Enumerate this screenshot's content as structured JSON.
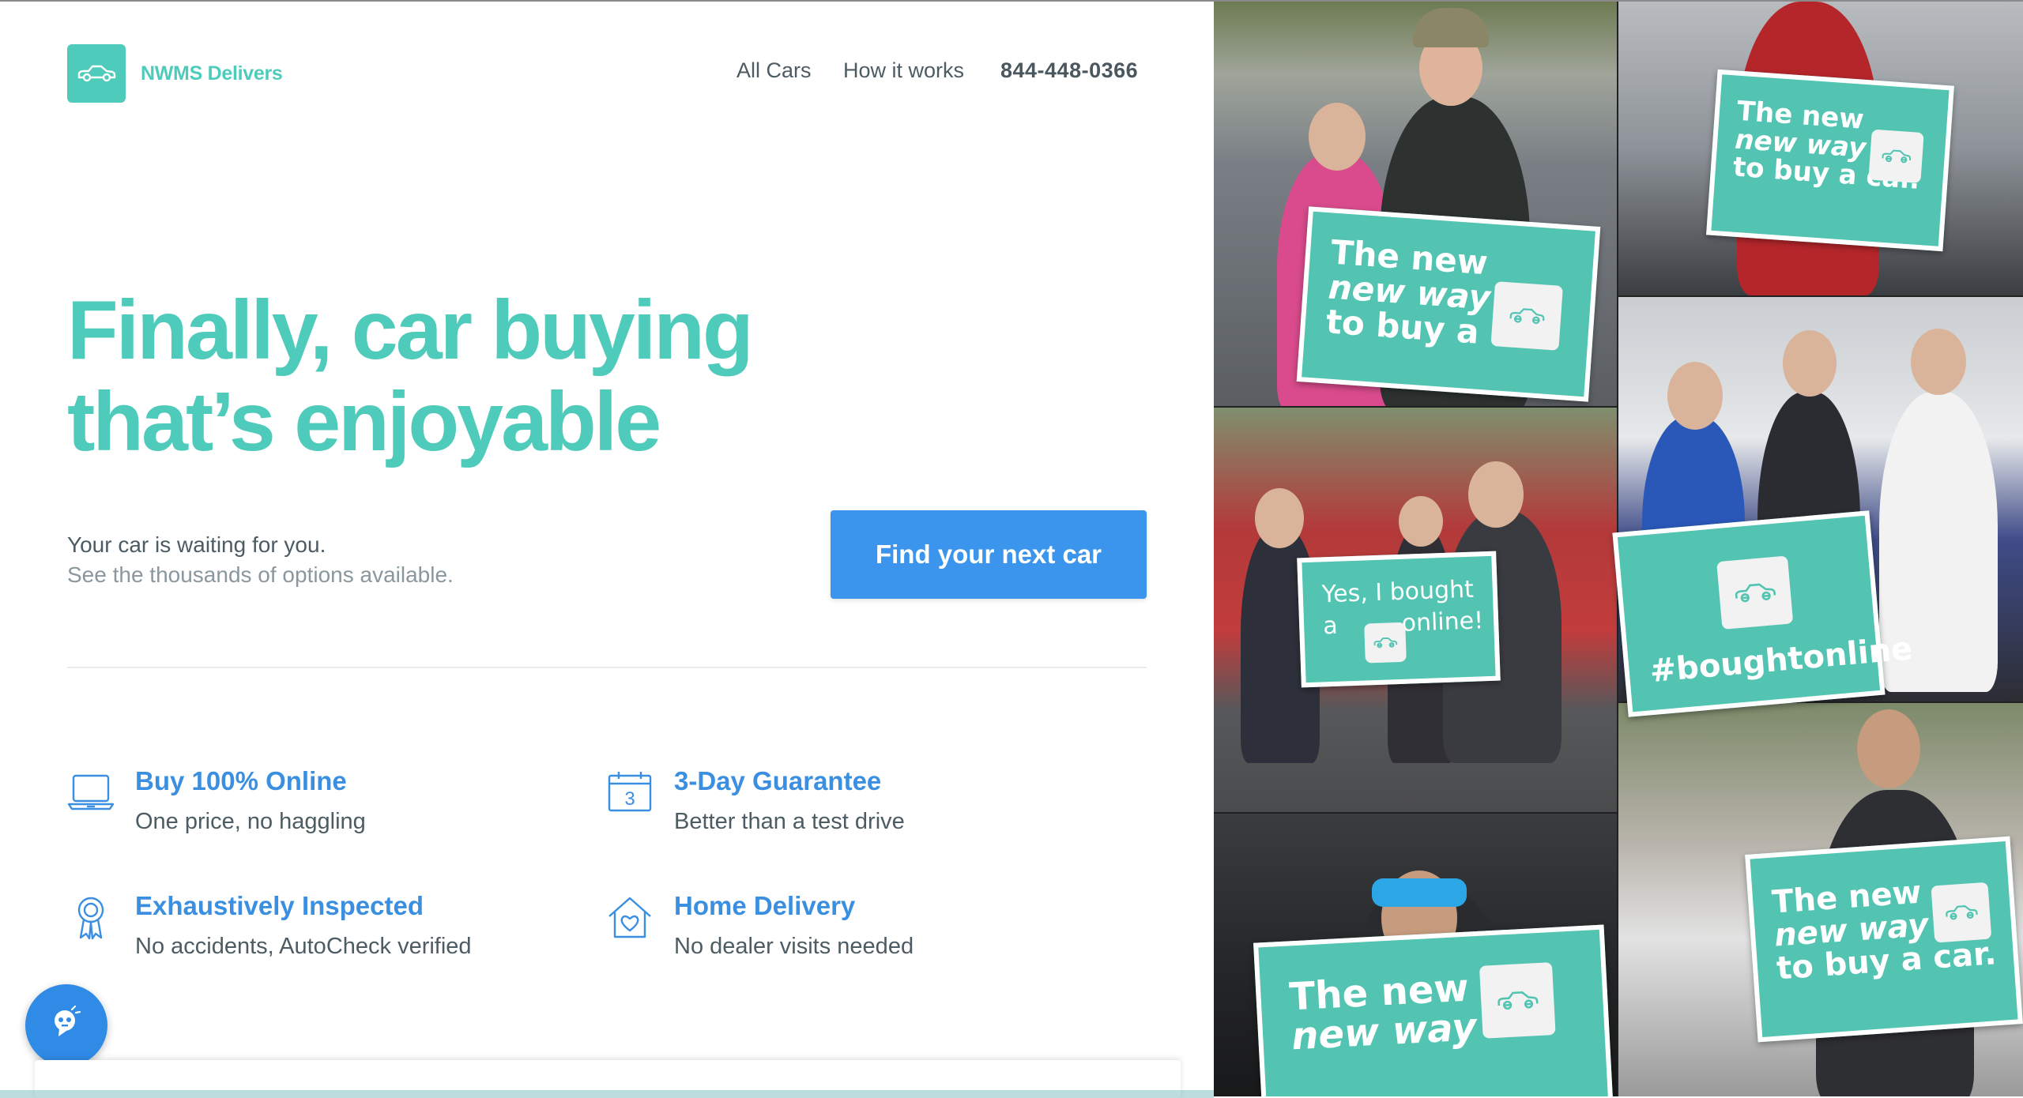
{
  "brand": {
    "name": "NWMS Delivers"
  },
  "nav": {
    "all_cars": "All Cars",
    "how_it_works": "How it works",
    "phone": "844-448-0366"
  },
  "hero": {
    "title_line1": "Finally, car buying",
    "title_line2": "that’s enjoyable",
    "subtitle": "Your car is waiting for you.",
    "subtitle_secondary": "See the thousands of options available.",
    "cta": "Find your next car"
  },
  "features": [
    {
      "icon": "laptop-icon",
      "title": "Buy 100% Online",
      "desc": "One price, no haggling"
    },
    {
      "icon": "calendar-icon",
      "title": "3-Day Guarantee",
      "desc": "Better than a test drive",
      "icon_number": "3"
    },
    {
      "icon": "ribbon-icon",
      "title": "Exhaustively Inspected",
      "desc": "No accidents, AutoCheck verified"
    },
    {
      "icon": "house-heart-icon",
      "title": "Home Delivery",
      "desc": "No dealer visits needed"
    }
  ],
  "collage": {
    "sign_new_way": {
      "line1": "The new",
      "line2": "new way",
      "line3": "to buy a car."
    },
    "sign_bought": {
      "line1": "Yes, I bought",
      "line2a": "a",
      "line2b": "online!"
    },
    "sign_hashtag": "#boughtonline"
  },
  "colors": {
    "brand_teal": "#4fcbbb",
    "cta_blue": "#3b95ec",
    "feature_blue": "#3b8fe0",
    "text_gray": "#4d5b63",
    "sign_teal": "#52c4b1"
  },
  "chat_widget": {
    "icon": "chat-assistant-icon"
  }
}
